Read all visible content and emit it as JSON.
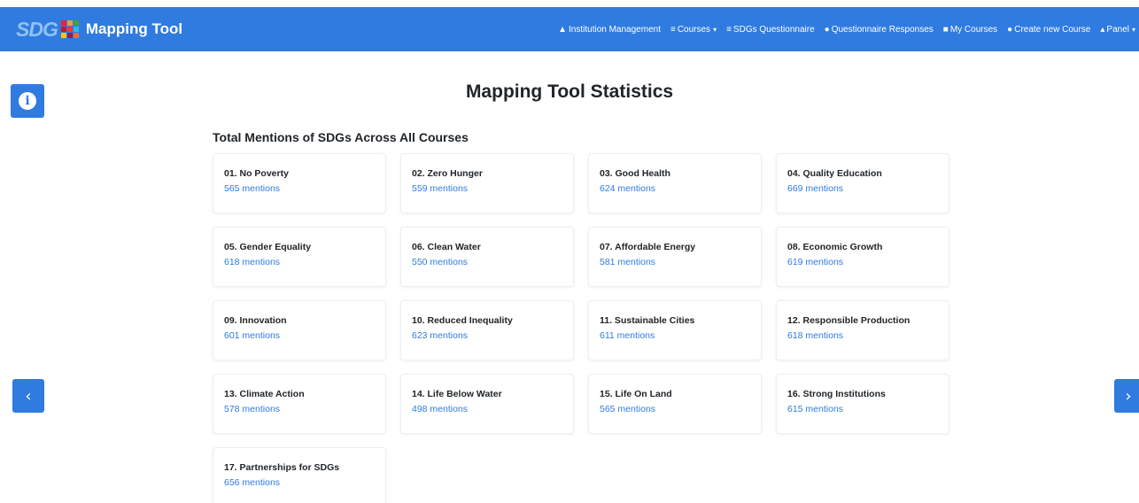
{
  "navbar": {
    "logo_text": "SDG",
    "logo_colors": [
      "#e5243b",
      "#dda63a",
      "#4c9f38",
      "#c5192d",
      "#ff3a21",
      "#26bde2",
      "#fcc30b",
      "#a21942",
      "#fd6925"
    ],
    "brand_title": "Mapping Tool",
    "links": [
      {
        "label": "Institution Management",
        "icon": "university-icon",
        "has_caret": false
      },
      {
        "label": "Courses",
        "icon": "courses-icon",
        "has_caret": true
      },
      {
        "label": "SDGs Questionnaire",
        "icon": "list-icon",
        "has_caret": false
      },
      {
        "label": "Questionnaire Responses",
        "icon": "question-circle-icon",
        "has_caret": false
      },
      {
        "label": "My Courses",
        "icon": "book-icon",
        "has_caret": false
      },
      {
        "label": "Create new Course",
        "icon": "plus-circle-icon",
        "has_caret": false
      },
      {
        "label": "Panel",
        "icon": "user-icon",
        "has_caret": true
      }
    ]
  },
  "page": {
    "title": "Mapping Tool Statistics",
    "section_title": "Total Mentions of SDGs Across All Courses"
  },
  "colors": {
    "primary": "#2f7be0",
    "card_border": "#eceff3"
  },
  "sdgs": [
    {
      "name": "01. No Poverty",
      "mentions": "565 mentions"
    },
    {
      "name": "02. Zero Hunger",
      "mentions": "559 mentions"
    },
    {
      "name": "03. Good Health",
      "mentions": "624 mentions"
    },
    {
      "name": "04. Quality Education",
      "mentions": "669 mentions"
    },
    {
      "name": "05. Gender Equality",
      "mentions": "618 mentions"
    },
    {
      "name": "06. Clean Water",
      "mentions": "550 mentions"
    },
    {
      "name": "07. Affordable Energy",
      "mentions": "581 mentions"
    },
    {
      "name": "08. Economic Growth",
      "mentions": "619 mentions"
    },
    {
      "name": "09. Innovation",
      "mentions": "601 mentions"
    },
    {
      "name": "10. Reduced Inequality",
      "mentions": "623 mentions"
    },
    {
      "name": "11. Sustainable Cities",
      "mentions": "611 mentions"
    },
    {
      "name": "12. Responsible Production",
      "mentions": "618 mentions"
    },
    {
      "name": "13. Climate Action",
      "mentions": "578 mentions"
    },
    {
      "name": "14. Life Below Water",
      "mentions": "498 mentions"
    },
    {
      "name": "15. Life On Land",
      "mentions": "565 mentions"
    },
    {
      "name": "16. Strong Institutions",
      "mentions": "615 mentions"
    },
    {
      "name": "17. Partnerships for SDGs",
      "mentions": "656 mentions"
    }
  ]
}
